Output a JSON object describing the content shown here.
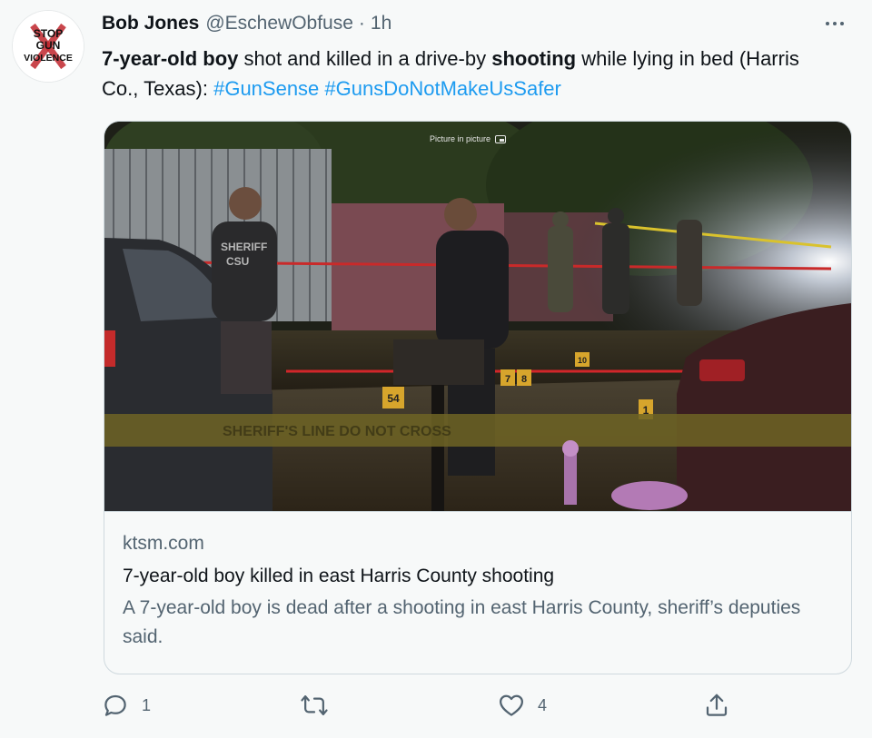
{
  "tweet": {
    "display_name": "Bob Jones",
    "handle": "@EschewObfuse",
    "separator": "·",
    "time": "1h",
    "avatar": {
      "lines": [
        "STOP",
        "GUN",
        "VIOLENCE"
      ],
      "colors": {
        "text": "#111111",
        "accent": "#c0262d"
      }
    },
    "text_parts": {
      "p1": "7-year-old boy",
      "p2": " shot and killed in a drive-by ",
      "p3": "shooting",
      "p4": " while lying in bed (Harris Co., Texas): ",
      "tag1": "#GunSense",
      "space": " ",
      "tag2": "#GunsDoNotMakeUsSafer"
    },
    "card": {
      "media_overlay": "Picture in picture",
      "photo_markers": [
        "54",
        "7",
        "8",
        "10",
        "1"
      ],
      "tape_text": "SHERIFF'S LINE DO NOT CROSS",
      "vest_text": "SHERIFF\nCSU",
      "domain": "ktsm.com",
      "title": "7-year-old boy killed in east Harris County shooting",
      "description": "A 7-year-old boy is dead after a shooting in east Harris County, sheriff’s deputies said."
    },
    "actions": {
      "reply_count": "1",
      "like_count": "4",
      "icons": [
        "reply-icon",
        "retweet-icon",
        "like-icon",
        "share-icon"
      ]
    }
  },
  "colors": {
    "link": "#1d9bf0",
    "secondary": "#536471",
    "text": "#0f1419",
    "border": "#cfd9de"
  }
}
